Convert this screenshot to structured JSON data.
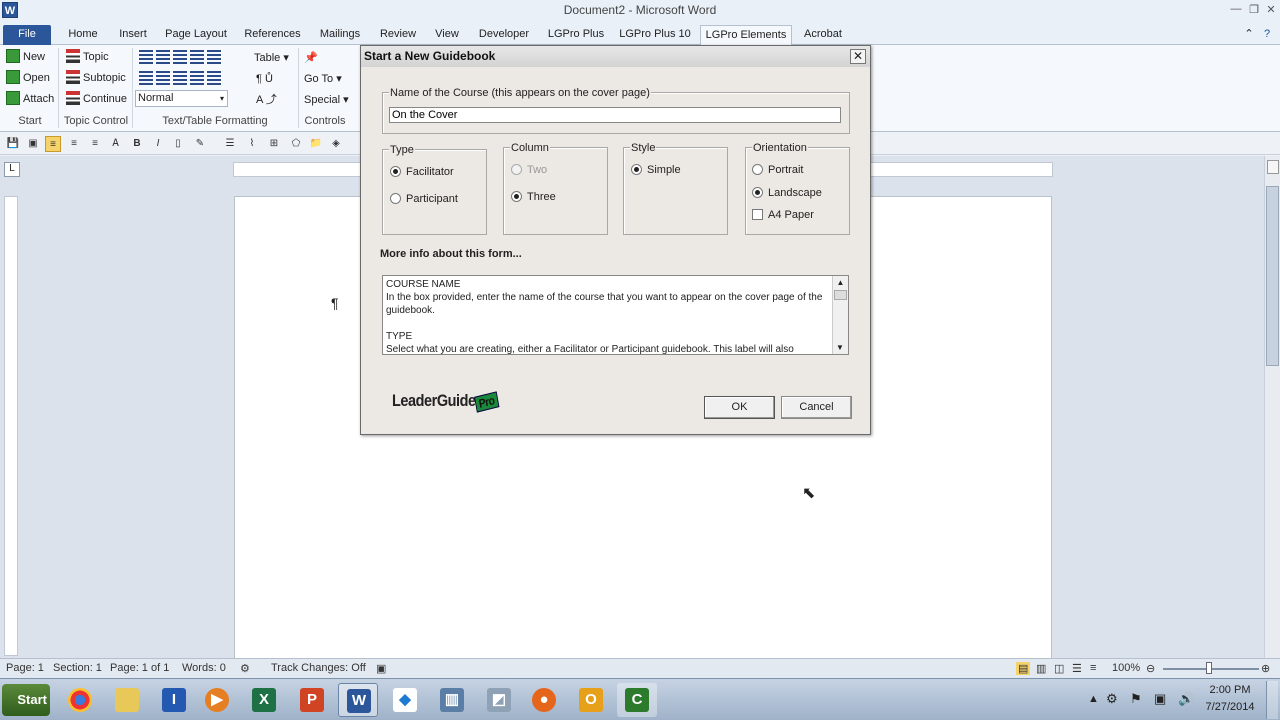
{
  "window": {
    "title": "Document2 - Microsoft Word",
    "app_icon": "W"
  },
  "tabs": [
    "File",
    "Home",
    "Insert",
    "Page Layout",
    "References",
    "Mailings",
    "Review",
    "View",
    "Developer",
    "LGPro Plus",
    "LGPro Plus 10",
    "LGPro Elements",
    "Acrobat"
  ],
  "active_tab": "LGPro Elements",
  "ribbon": {
    "start": {
      "new": "New",
      "open": "Open",
      "attach": "Attach",
      "group": "Start"
    },
    "topic_control": {
      "topic": "Topic",
      "subtopic": "Subtopic",
      "continue": "Continue",
      "group": "Topic Control"
    },
    "text_table": {
      "table": "Table",
      "style_value": "Normal",
      "group": "Text/Table Formatting"
    },
    "controls": {
      "goto": "Go To",
      "special": "Special",
      "group": "Controls"
    }
  },
  "dialog": {
    "title": "Start a New Guidebook",
    "course_legend": "Name of the Course (this appears on the cover page)",
    "course_value": "On the Cover",
    "type": {
      "legend": "Type",
      "options": [
        "Facilitator",
        "Participant"
      ],
      "selected": "Facilitator"
    },
    "column": {
      "legend": "Column",
      "options": [
        "Two",
        "Three"
      ],
      "selected": "Three",
      "disabled": "Two"
    },
    "style": {
      "legend": "Style",
      "options": [
        "Simple"
      ],
      "selected": "Simple"
    },
    "orientation": {
      "legend": "Orientation",
      "options": [
        "Portrait",
        "Landscape"
      ],
      "selected": "Landscape",
      "a4": "A4 Paper"
    },
    "more_info": "More info about this form...",
    "info_lines": [
      "COURSE NAME",
      "In the box provided, enter the name of the course that you want to appear on the cover page of the guidebook.",
      "",
      "TYPE",
      "Select what you are creating, either a Facilitator or Participant guidebook. This label will also"
    ],
    "logo_text": "LeaderGuide",
    "logo_badge": "Pro",
    "ok": "OK",
    "cancel": "Cancel"
  },
  "document": {
    "pilcrow": "¶"
  },
  "status": {
    "page": "Page: 1",
    "section": "Section: 1",
    "pages": "Page: 1 of 1",
    "words": "Words: 0",
    "track": "Track Changes: Off",
    "zoom": "100%"
  },
  "taskbar": {
    "start": "Start",
    "time": "2:00 PM",
    "date": "7/27/2014"
  }
}
